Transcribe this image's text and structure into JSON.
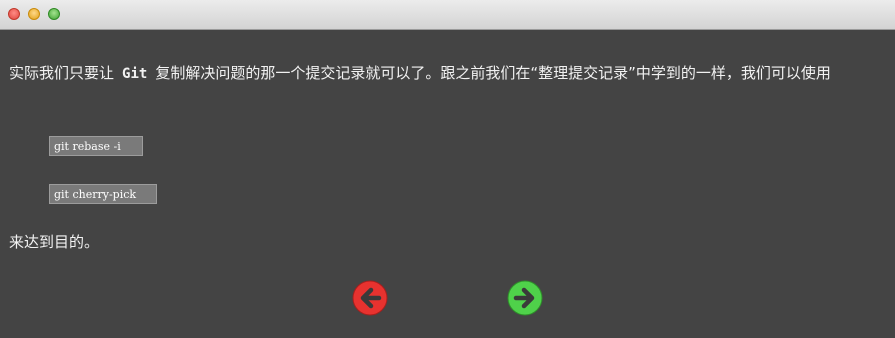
{
  "window": {
    "buttons": [
      "close",
      "minimize",
      "zoom"
    ]
  },
  "content": {
    "paragraph_before": "实际我们只要让",
    "code_word": "Git",
    "paragraph_after": "复制解决问题的那一个提交记录就可以了。跟之前我们在“整理提交记录”中学到的一样，我们可以使用",
    "commands": [
      "git rebase -i",
      "git cherry-pick"
    ],
    "closing": "来达到目的。"
  },
  "nav": {
    "prev_icon": "arrow-left-icon",
    "next_icon": "arrow-right-icon",
    "prev_color": "#e8322f",
    "next_color": "#4fd14a"
  }
}
